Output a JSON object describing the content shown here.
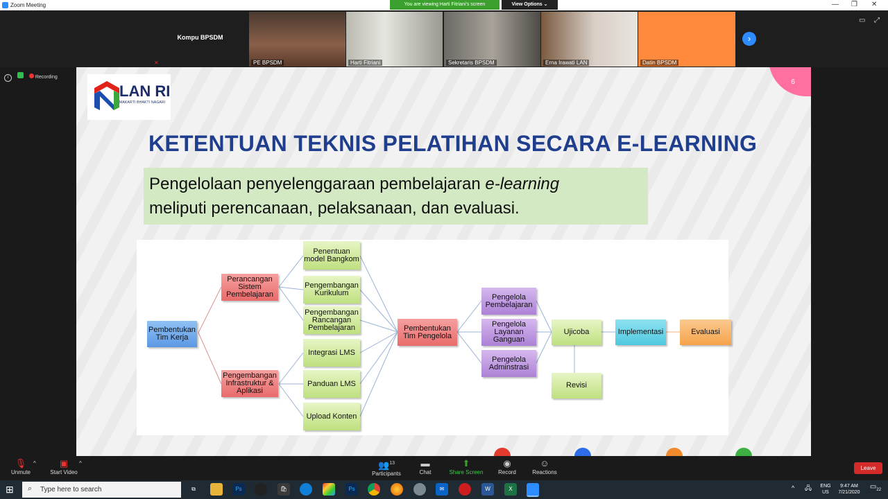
{
  "window": {
    "title": "Zoom Meeting",
    "banner": "You are viewing Harti Fitriani's screen",
    "view_options": "View Options ⌄"
  },
  "participants_strip": {
    "tiles": [
      {
        "name": "Kompu BPSDM",
        "label": "",
        "color": "#1e1e1e"
      },
      {
        "name": "",
        "label": "PE BPSDM",
        "color": "#6b4a3a"
      },
      {
        "name": "",
        "label": "Harti Fitriani",
        "color": "#8c8f86"
      },
      {
        "name": "",
        "label": "Sekretaris BPSDM",
        "color": "#6d6a62"
      },
      {
        "name": "",
        "label": "Erna Irawati LAN",
        "color": "#8a6e55"
      },
      {
        "name": "",
        "label": "Datin BPSDM",
        "color": "#ff8a3d"
      }
    ]
  },
  "status": {
    "recording": "Recording"
  },
  "slide": {
    "page_number": "6",
    "logo_text": "LAN RI",
    "logo_tagline": "MAKARTI BHAKTI NAGARI",
    "title": "KETENTUAN TEKNIS PELATIHAN SECARA E-LEARNING",
    "subtitle_line1_a": "Pengelolaan penyelenggaraan pembelajaran ",
    "subtitle_line1_b": "e-learning",
    "subtitle_line2": "meliputi perencanaan, pelaksanaan, dan evaluasi.",
    "nodes": {
      "tim_kerja": "Pembentukan Tim Kerja",
      "perancangan": "Perancangan Sistem Pembelajaran",
      "infra": "Pengembangan Infrastruktur & Aplikasi",
      "model": "Penentuan model Bangkom",
      "kurikulum": "Pengembangan Kurikulum",
      "rancangan": "Pengembangan Rancangan Pembelajaran",
      "lms": "Integrasi LMS",
      "panduan": "Panduan LMS",
      "upload": "Upload Konten",
      "tim_pengelola": "Pembentukan Tim Pengelola",
      "p_pembelajaran": "Pengelola Pembelajaran",
      "p_layanan": "Pengelola Layanan Ganguan",
      "p_admin": "Pengelola Adminstrasi",
      "ujicoba": "Ujicoba",
      "revisi": "Revisi",
      "implementasi": "Implementasi",
      "evaluasi": "Evaluasi"
    }
  },
  "toolbar": {
    "unmute": "Unmute",
    "start_video": "Start Video",
    "participants": "Participants",
    "participants_count": "13",
    "chat": "Chat",
    "share_screen": "Share Screen",
    "record": "Record",
    "reactions": "Reactions",
    "leave": "Leave"
  },
  "taskbar": {
    "search_placeholder": "Type here to search",
    "lang_top": "ENG",
    "lang_bottom": "US",
    "time": "9:47 AM",
    "date": "7/21/2020",
    "notif_count": "22"
  },
  "colors": {
    "zoom_blue": "#2d8cff",
    "banner_green": "#3ba02d",
    "leave_red": "#d32a2a",
    "title_blue": "#203e8e"
  }
}
